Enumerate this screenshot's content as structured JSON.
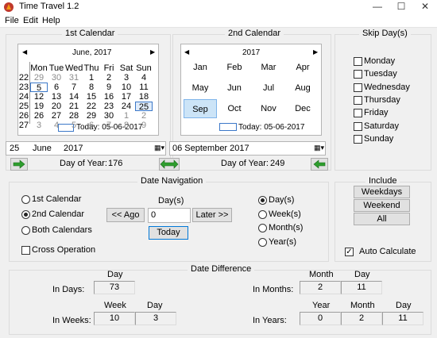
{
  "window": {
    "title": "Time Travel 1.2",
    "minimize": "—",
    "maximize": "☐",
    "close": "✕"
  },
  "menu": [
    "File",
    "Edit",
    "Help"
  ],
  "cal1": {
    "group_title": "1st Calendar",
    "header": "June, 2017",
    "weekdays": [
      "Mon",
      "Tue",
      "Wed",
      "Thu",
      "Fri",
      "Sat",
      "Sun"
    ],
    "weeks": [
      {
        "num": "22",
        "days": [
          "29",
          "30",
          "31",
          "1",
          "2",
          "3",
          "4"
        ]
      },
      {
        "num": "23",
        "days": [
          "5",
          "6",
          "7",
          "8",
          "9",
          "10",
          "11"
        ]
      },
      {
        "num": "24",
        "days": [
          "12",
          "13",
          "14",
          "15",
          "16",
          "17",
          "18"
        ]
      },
      {
        "num": "25",
        "days": [
          "19",
          "20",
          "21",
          "22",
          "23",
          "24",
          "25"
        ]
      },
      {
        "num": "26",
        "days": [
          "26",
          "27",
          "28",
          "29",
          "30",
          "1",
          "2"
        ]
      },
      {
        "num": "27",
        "days": [
          "3",
          "4",
          "5",
          "6",
          "7",
          "8",
          "9"
        ]
      }
    ],
    "today_label": "Today: 05-06-2017",
    "date_day": "25",
    "date_month": "June",
    "date_year": "2017",
    "day_of_year_label": "Day of Year:",
    "day_of_year": "176"
  },
  "cal2": {
    "group_title": "2nd Calendar",
    "header": "2017",
    "months": [
      "Jan",
      "Feb",
      "Mar",
      "Apr",
      "May",
      "Jun",
      "Jul",
      "Aug",
      "Sep",
      "Oct",
      "Nov",
      "Dec"
    ],
    "today_label": "Today: 05-06-2017",
    "date_text": "06 September 2017",
    "day_of_year_label": "Day of Year:",
    "day_of_year": "249"
  },
  "skip": {
    "title": "Skip Day(s)",
    "days": [
      "Monday",
      "Tuesday",
      "Wednesday",
      "Thursday",
      "Friday",
      "Saturday",
      "Sunday"
    ]
  },
  "nav": {
    "title": "Date Navigation",
    "radio_cal": [
      "1st Calendar",
      "2nd Calendar",
      "Both Calendars"
    ],
    "cross": "Cross Operation",
    "days_label": "Day(s)",
    "days_value": "0",
    "ago": "<< Ago",
    "later": "Later >>",
    "today": "Today",
    "units": [
      "Day(s)",
      "Week(s)",
      "Month(s)",
      "Year(s)"
    ]
  },
  "include": {
    "title": "Include",
    "weekdays": "Weekdays",
    "weekend": "Weekend",
    "all": "All",
    "auto": "Auto Calculate"
  },
  "diff": {
    "title": "Date Difference",
    "in_days": "In Days:",
    "day_head": "Day",
    "days": "73",
    "in_weeks": "In Weeks:",
    "week_head": "Week",
    "weeks": "10",
    "weeks_day_head": "Day",
    "weeks_days": "3",
    "in_months": "In Months:",
    "month_head": "Month",
    "months": "2",
    "months_day_head": "Day",
    "months_days": "11",
    "in_years": "In Years:",
    "year_head": "Year",
    "years": "0",
    "years_month_head": "Month",
    "years_months": "2",
    "years_day_head": "Day",
    "years_days": "11"
  }
}
